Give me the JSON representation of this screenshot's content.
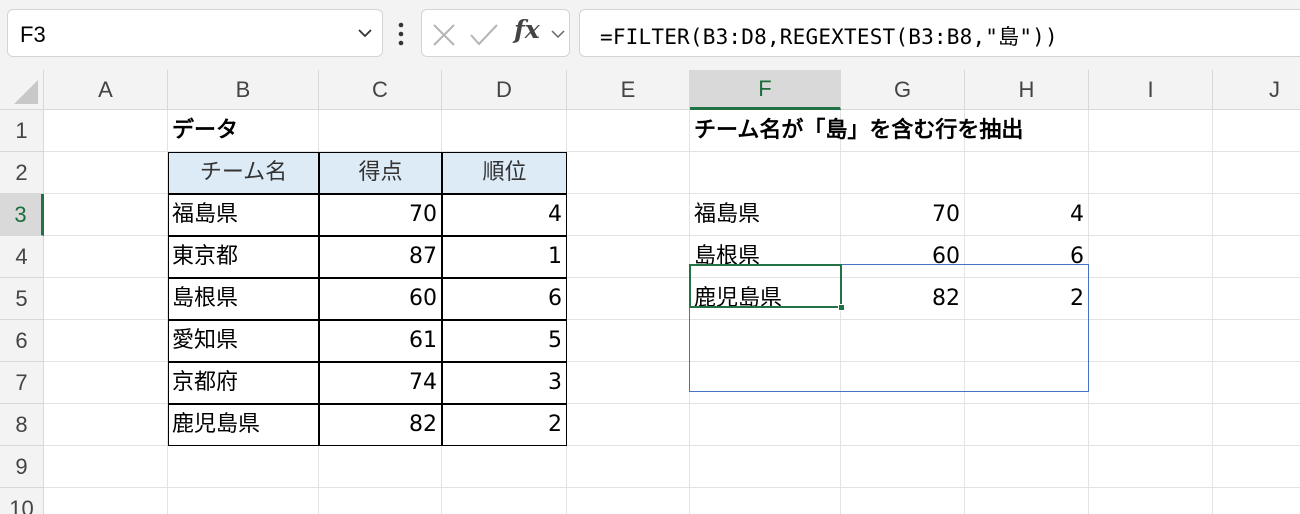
{
  "formula_bar": {
    "name_box": "F3",
    "formula": "=FILTER(B3:D8,REGEXTEST(B3:B8,\"島\"))",
    "fx_label": "fx"
  },
  "columns": [
    "A",
    "B",
    "C",
    "D",
    "E",
    "F",
    "G",
    "H",
    "I",
    "J"
  ],
  "rows": [
    "1",
    "2",
    "3",
    "4",
    "5",
    "6",
    "7",
    "8",
    "9",
    "10"
  ],
  "active_column": "F",
  "active_row": "3",
  "source": {
    "title": "データ",
    "headers": [
      "チーム名",
      "得点",
      "順位"
    ],
    "rows": [
      [
        "福島県",
        "70",
        "4"
      ],
      [
        "東京都",
        "87",
        "1"
      ],
      [
        "島根県",
        "60",
        "6"
      ],
      [
        "愛知県",
        "61",
        "5"
      ],
      [
        "京都府",
        "74",
        "3"
      ],
      [
        "鹿児島県",
        "82",
        "2"
      ]
    ]
  },
  "result": {
    "title": "チーム名が「島」を含む行を抽出",
    "rows": [
      [
        "福島県",
        "70",
        "4"
      ],
      [
        "島根県",
        "60",
        "6"
      ],
      [
        "鹿児島県",
        "82",
        "2"
      ]
    ]
  },
  "colors": {
    "accent_green": "#217346",
    "spill_border": "#4472c4",
    "header_fill": "#ddebf7"
  }
}
